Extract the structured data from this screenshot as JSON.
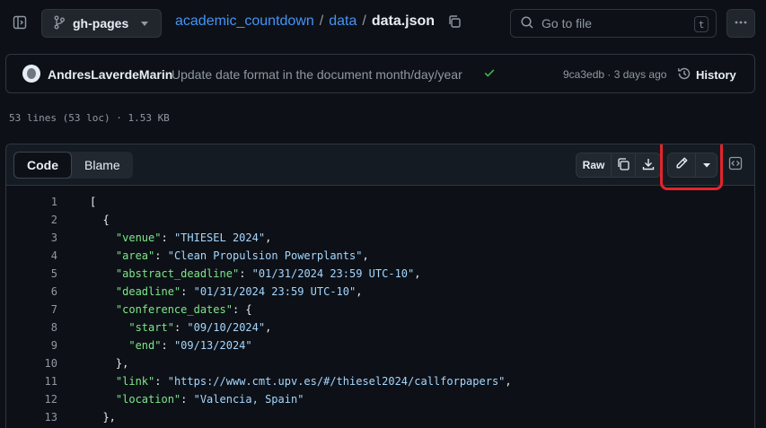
{
  "header": {
    "branch": "gh-pages",
    "breadcrumb": {
      "repo": "academic_countdown",
      "folder": "data",
      "file": "data.json",
      "separator": "/"
    },
    "goto_file_placeholder": "Go to file",
    "goto_file_shortcut": "t"
  },
  "commit": {
    "author": "AndresLaverdeMarin",
    "message": "Update date format in the document month/day/year",
    "sha_and_time": "9ca3edb · 3 days ago",
    "history_label": "History",
    "status_color": "#3fb950"
  },
  "file_meta": "53 lines (53 loc) · 1.53 KB",
  "viewer": {
    "tabs": [
      "Code",
      "Blame"
    ],
    "active_tab": "Code",
    "raw_label": "Raw",
    "highlight_color": "#e5242b"
  },
  "code_lines": [
    {
      "num": "1",
      "indent": "",
      "parts": [
        [
          "p",
          "["
        ]
      ]
    },
    {
      "num": "2",
      "indent": "  ",
      "parts": [
        [
          "p",
          "{"
        ]
      ]
    },
    {
      "num": "3",
      "indent": "    ",
      "parts": [
        [
          "k",
          "\"venue\""
        ],
        [
          "p",
          ": "
        ],
        [
          "s",
          "\"THIESEL 2024\""
        ],
        [
          "p",
          ","
        ]
      ]
    },
    {
      "num": "4",
      "indent": "    ",
      "parts": [
        [
          "k",
          "\"area\""
        ],
        [
          "p",
          ": "
        ],
        [
          "s",
          "\"Clean Propulsion Powerplants\""
        ],
        [
          "p",
          ","
        ]
      ]
    },
    {
      "num": "5",
      "indent": "    ",
      "parts": [
        [
          "k",
          "\"abstract_deadline\""
        ],
        [
          "p",
          ": "
        ],
        [
          "s",
          "\"01/31/2024 23:59 UTC-10\""
        ],
        [
          "p",
          ","
        ]
      ]
    },
    {
      "num": "6",
      "indent": "    ",
      "parts": [
        [
          "k",
          "\"deadline\""
        ],
        [
          "p",
          ": "
        ],
        [
          "s",
          "\"01/31/2024 23:59 UTC-10\""
        ],
        [
          "p",
          ","
        ]
      ]
    },
    {
      "num": "7",
      "indent": "    ",
      "parts": [
        [
          "k",
          "\"conference_dates\""
        ],
        [
          "p",
          ": {"
        ]
      ]
    },
    {
      "num": "8",
      "indent": "      ",
      "parts": [
        [
          "k",
          "\"start\""
        ],
        [
          "p",
          ": "
        ],
        [
          "s",
          "\"09/10/2024\""
        ],
        [
          "p",
          ","
        ]
      ]
    },
    {
      "num": "9",
      "indent": "      ",
      "parts": [
        [
          "k",
          "\"end\""
        ],
        [
          "p",
          ": "
        ],
        [
          "s",
          "\"09/13/2024\""
        ]
      ]
    },
    {
      "num": "10",
      "indent": "    ",
      "parts": [
        [
          "p",
          "},"
        ]
      ]
    },
    {
      "num": "11",
      "indent": "    ",
      "parts": [
        [
          "k",
          "\"link\""
        ],
        [
          "p",
          ": "
        ],
        [
          "s",
          "\"https://www.cmt.upv.es/#/thiesel2024/callforpapers\""
        ],
        [
          "p",
          ","
        ]
      ]
    },
    {
      "num": "12",
      "indent": "    ",
      "parts": [
        [
          "k",
          "\"location\""
        ],
        [
          "p",
          ": "
        ],
        [
          "s",
          "\"Valencia, Spain\""
        ]
      ]
    },
    {
      "num": "13",
      "indent": "  ",
      "parts": [
        [
          "p",
          "},"
        ]
      ]
    }
  ]
}
